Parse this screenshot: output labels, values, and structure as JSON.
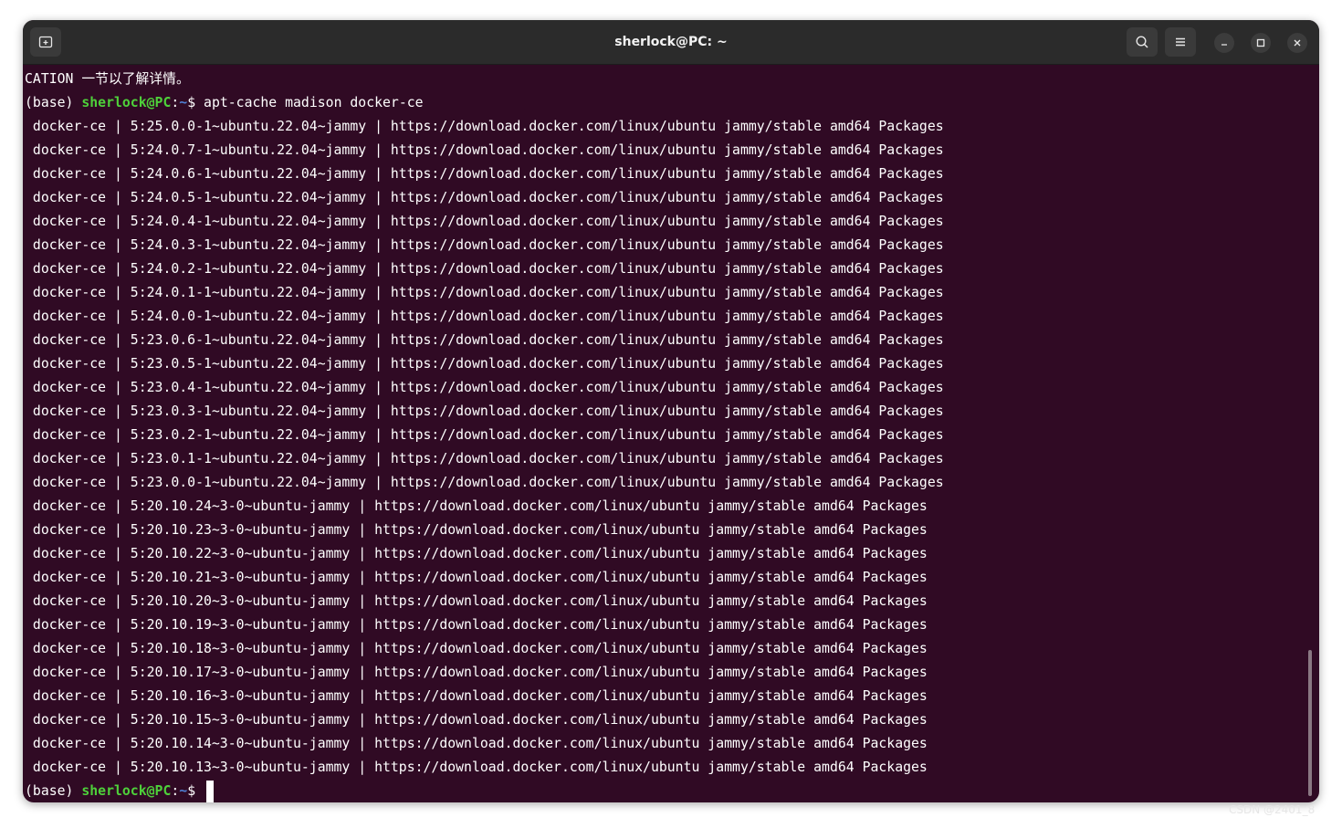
{
  "window": {
    "title": "sherlock@PC: ~"
  },
  "icons": {
    "new_tab": "new-tab-icon",
    "search": "search-icon",
    "menu": "hamburger-menu-icon",
    "minimize": "minimize-icon",
    "maximize": "maximize-icon",
    "close": "close-icon"
  },
  "colors": {
    "terminal_bg": "#300a24",
    "titlebar_bg": "#2b2b2b",
    "prompt_user": "#4ed03a",
    "prompt_path": "#4f80d4",
    "text": "#ffffff"
  },
  "terminal": {
    "first_line": "CATION 一节以了解详情。",
    "prompt": {
      "env": "(base) ",
      "user_host": "sherlock@PC",
      "colon": ":",
      "path": "~",
      "symbol": "$ "
    },
    "command": "apt-cache madison docker-ce",
    "output": [
      " docker-ce | 5:25.0.0-1~ubuntu.22.04~jammy | https://download.docker.com/linux/ubuntu jammy/stable amd64 Packages",
      " docker-ce | 5:24.0.7-1~ubuntu.22.04~jammy | https://download.docker.com/linux/ubuntu jammy/stable amd64 Packages",
      " docker-ce | 5:24.0.6-1~ubuntu.22.04~jammy | https://download.docker.com/linux/ubuntu jammy/stable amd64 Packages",
      " docker-ce | 5:24.0.5-1~ubuntu.22.04~jammy | https://download.docker.com/linux/ubuntu jammy/stable amd64 Packages",
      " docker-ce | 5:24.0.4-1~ubuntu.22.04~jammy | https://download.docker.com/linux/ubuntu jammy/stable amd64 Packages",
      " docker-ce | 5:24.0.3-1~ubuntu.22.04~jammy | https://download.docker.com/linux/ubuntu jammy/stable amd64 Packages",
      " docker-ce | 5:24.0.2-1~ubuntu.22.04~jammy | https://download.docker.com/linux/ubuntu jammy/stable amd64 Packages",
      " docker-ce | 5:24.0.1-1~ubuntu.22.04~jammy | https://download.docker.com/linux/ubuntu jammy/stable amd64 Packages",
      " docker-ce | 5:24.0.0-1~ubuntu.22.04~jammy | https://download.docker.com/linux/ubuntu jammy/stable amd64 Packages",
      " docker-ce | 5:23.0.6-1~ubuntu.22.04~jammy | https://download.docker.com/linux/ubuntu jammy/stable amd64 Packages",
      " docker-ce | 5:23.0.5-1~ubuntu.22.04~jammy | https://download.docker.com/linux/ubuntu jammy/stable amd64 Packages",
      " docker-ce | 5:23.0.4-1~ubuntu.22.04~jammy | https://download.docker.com/linux/ubuntu jammy/stable amd64 Packages",
      " docker-ce | 5:23.0.3-1~ubuntu.22.04~jammy | https://download.docker.com/linux/ubuntu jammy/stable amd64 Packages",
      " docker-ce | 5:23.0.2-1~ubuntu.22.04~jammy | https://download.docker.com/linux/ubuntu jammy/stable amd64 Packages",
      " docker-ce | 5:23.0.1-1~ubuntu.22.04~jammy | https://download.docker.com/linux/ubuntu jammy/stable amd64 Packages",
      " docker-ce | 5:23.0.0-1~ubuntu.22.04~jammy | https://download.docker.com/linux/ubuntu jammy/stable amd64 Packages",
      " docker-ce | 5:20.10.24~3-0~ubuntu-jammy | https://download.docker.com/linux/ubuntu jammy/stable amd64 Packages",
      " docker-ce | 5:20.10.23~3-0~ubuntu-jammy | https://download.docker.com/linux/ubuntu jammy/stable amd64 Packages",
      " docker-ce | 5:20.10.22~3-0~ubuntu-jammy | https://download.docker.com/linux/ubuntu jammy/stable amd64 Packages",
      " docker-ce | 5:20.10.21~3-0~ubuntu-jammy | https://download.docker.com/linux/ubuntu jammy/stable amd64 Packages",
      " docker-ce | 5:20.10.20~3-0~ubuntu-jammy | https://download.docker.com/linux/ubuntu jammy/stable amd64 Packages",
      " docker-ce | 5:20.10.19~3-0~ubuntu-jammy | https://download.docker.com/linux/ubuntu jammy/stable amd64 Packages",
      " docker-ce | 5:20.10.18~3-0~ubuntu-jammy | https://download.docker.com/linux/ubuntu jammy/stable amd64 Packages",
      " docker-ce | 5:20.10.17~3-0~ubuntu-jammy | https://download.docker.com/linux/ubuntu jammy/stable amd64 Packages",
      " docker-ce | 5:20.10.16~3-0~ubuntu-jammy | https://download.docker.com/linux/ubuntu jammy/stable amd64 Packages",
      " docker-ce | 5:20.10.15~3-0~ubuntu-jammy | https://download.docker.com/linux/ubuntu jammy/stable amd64 Packages",
      " docker-ce | 5:20.10.14~3-0~ubuntu-jammy | https://download.docker.com/linux/ubuntu jammy/stable amd64 Packages",
      " docker-ce | 5:20.10.13~3-0~ubuntu-jammy | https://download.docker.com/linux/ubuntu jammy/stable amd64 Packages"
    ]
  },
  "watermark": "CSDN @2401_8"
}
